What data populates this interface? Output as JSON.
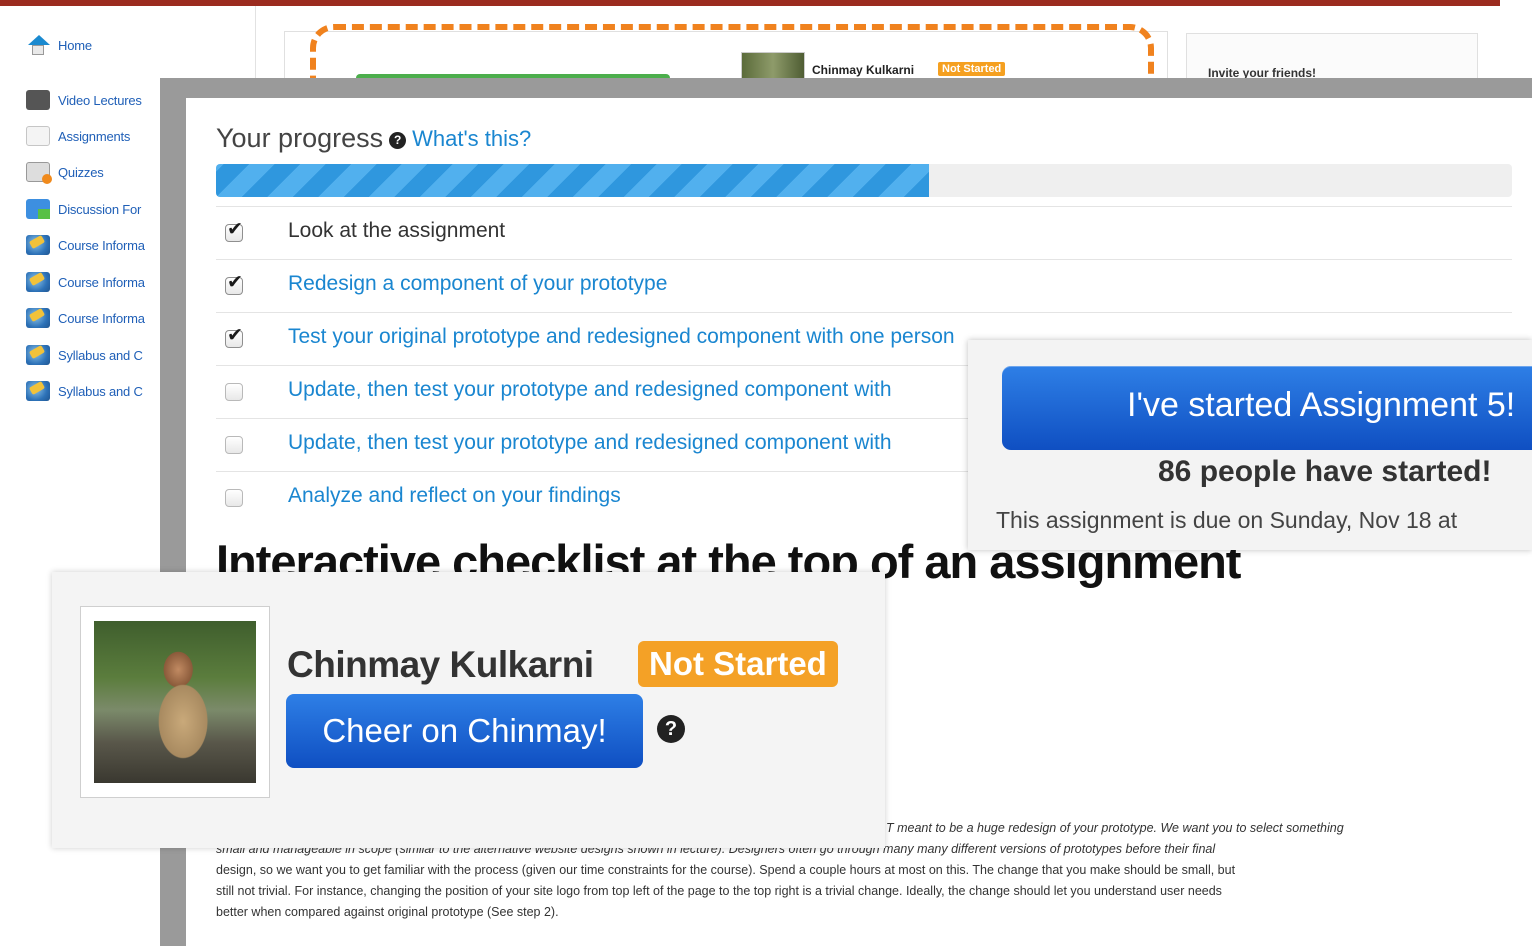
{
  "sidebar": {
    "items": [
      {
        "label": "Home",
        "icon": "home-icon"
      },
      {
        "label": "Video Lectures",
        "icon": "video-icon"
      },
      {
        "label": "Assignments",
        "icon": "assignment-icon"
      },
      {
        "label": "Quizzes",
        "icon": "quiz-icon"
      },
      {
        "label": "Discussion For",
        "icon": "discussion-icon"
      },
      {
        "label": "Course Informa",
        "icon": "info-icon"
      },
      {
        "label": "Course Informa",
        "icon": "info-icon"
      },
      {
        "label": "Course Informa",
        "icon": "info-icon"
      },
      {
        "label": "Syllabus and C",
        "icon": "info-icon"
      },
      {
        "label": "Syllabus and C",
        "icon": "info-icon"
      }
    ]
  },
  "background": {
    "profile_name": "Chinmay Kulkarni",
    "status": "Not Started",
    "invite": "Invite your friends!"
  },
  "progress": {
    "title": "Your progress",
    "help_glyph": "?",
    "whats_this": "What's this?",
    "fraction": 0.55
  },
  "checklist": [
    {
      "label": "Look at the assignment",
      "checked": true,
      "link": false
    },
    {
      "label": "Redesign a component of your prototype",
      "checked": true,
      "link": true
    },
    {
      "label": "Test your original prototype and redesigned component with one person",
      "checked": true,
      "link": true
    },
    {
      "label": "Update, then test your prototype and redesigned component with",
      "checked": false,
      "link": true
    },
    {
      "label": "Update, then test your prototype and redesigned component with",
      "checked": false,
      "link": true
    },
    {
      "label": "Analyze and reflect on your findings",
      "checked": false,
      "link": true
    }
  ],
  "heading": "Interactive checklist at the top of an assignment",
  "body": {
    "line1": "T meant to be a huge redesign of your prototype. We want you to select something",
    "line2": "small and manageable in scope (similar to the alternative website designs shown in lecture). Designers often go through many many different versions of prototypes before their final",
    "line3": "design, so we want you to get familiar with the process (given our time constraints for the course). Spend a couple hours at most on this. The change that you make should be small, but",
    "line4": "still not trivial. For instance, changing the position of your site logo from top left of the page to the top right is a trivial change. Ideally, the change should let you understand user needs",
    "line5": "better when compared against original prototype (See step 2)."
  },
  "started": {
    "button": "I've started Assignment 5!",
    "count_text": "86 people have started!",
    "due_text": "This assignment is due on Sunday, Nov 18 at"
  },
  "profile": {
    "name": "Chinmay Kulkarni",
    "status": "Not Started",
    "cheer_button": "Cheer on Chinmay!",
    "help_glyph": "?"
  },
  "colors": {
    "accent_blue": "#1a86d0",
    "button_blue": "#0f4fc2",
    "badge_orange": "#f4a126",
    "dashed_orange": "#f0821e",
    "top_bar": "#9b2b1f"
  }
}
